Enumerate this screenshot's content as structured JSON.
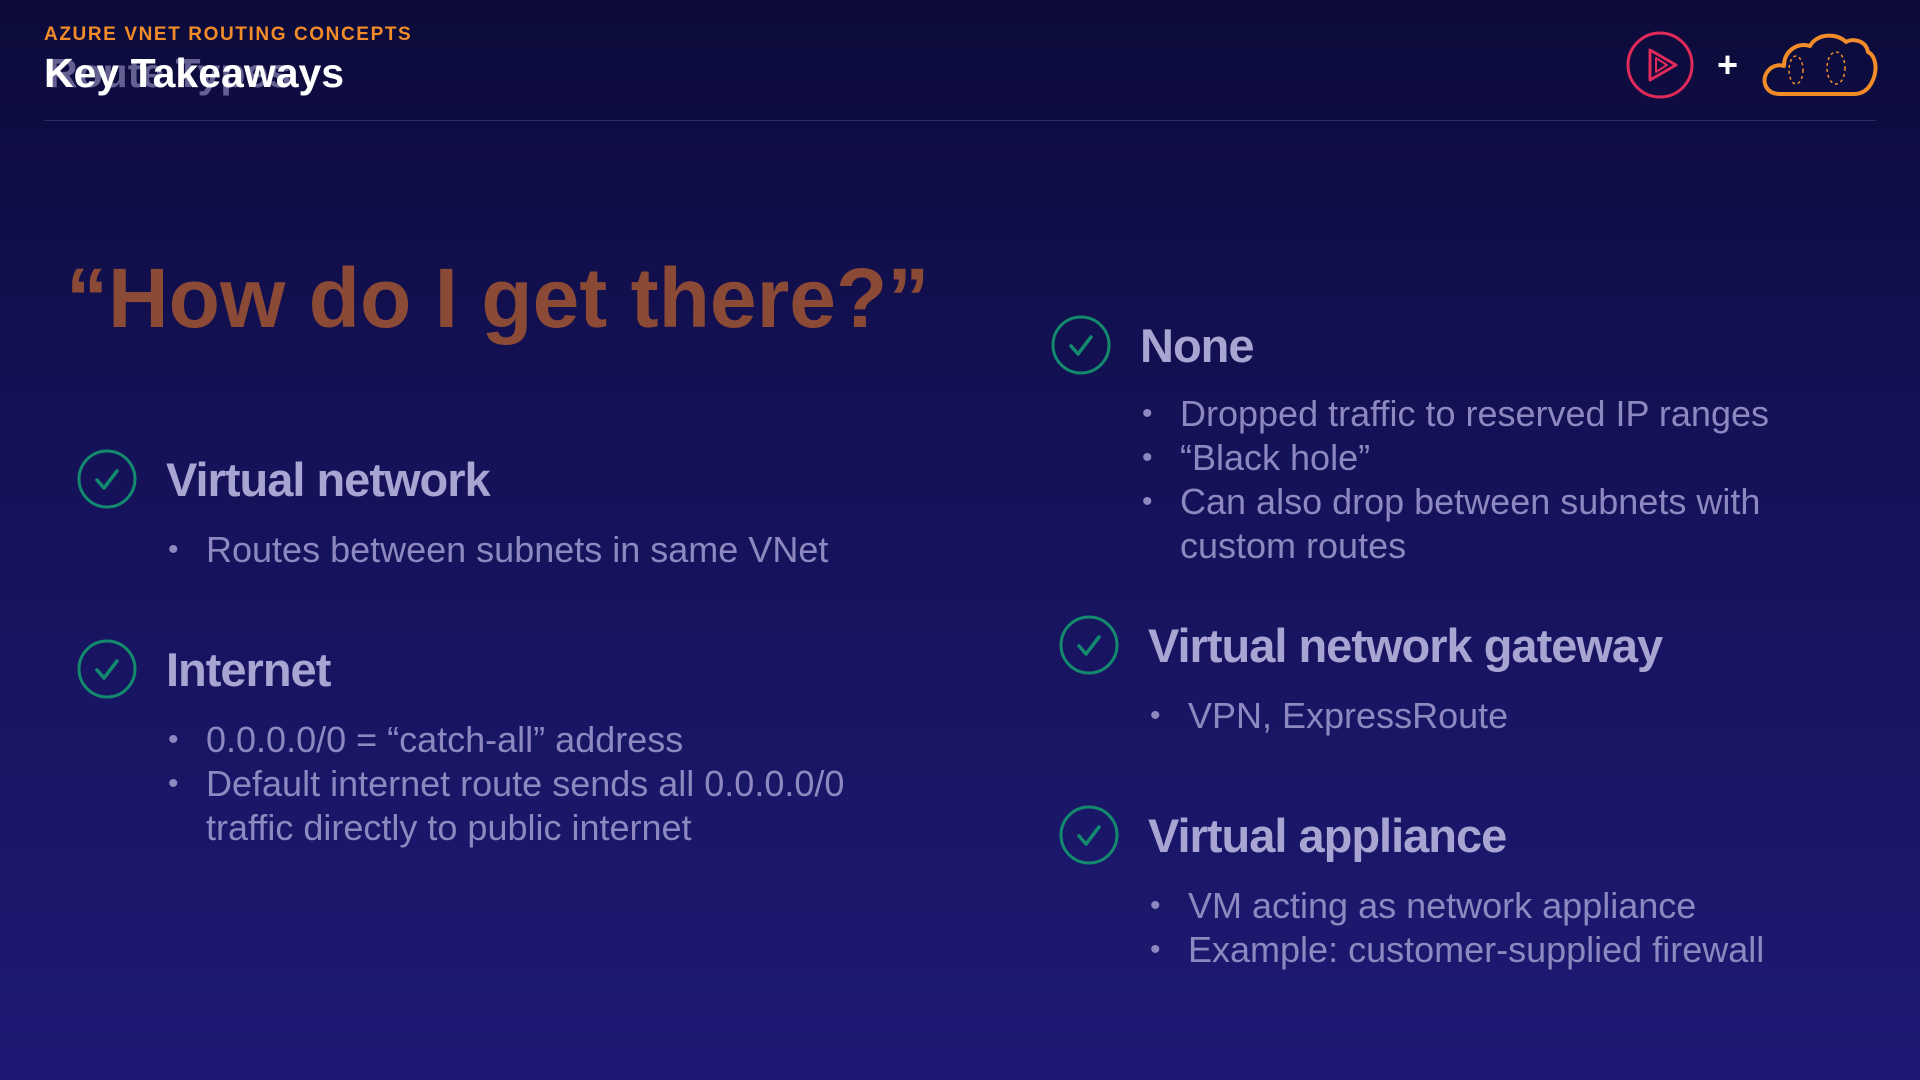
{
  "header": {
    "eyebrow": "AZURE VNET ROUTING CONCEPTS",
    "title": "Key Takeaways",
    "title_ghost": "Route Types"
  },
  "logos": {
    "play_logo": "play-logo-icon",
    "plus": "+",
    "cloud_logo": "cloud-logo-icon"
  },
  "headline": "“How do I get there?”",
  "routes_left": [
    {
      "name": "Virtual network",
      "bullets": [
        "Routes between subnets in same VNet"
      ]
    },
    {
      "name": "Internet",
      "bullets": [
        "0.0.0.0/0 = “catch-all” address",
        "Default internet route sends all 0.0.0.0/0",
        "traffic directly to public internet"
      ]
    }
  ],
  "routes_right": [
    {
      "name": "None",
      "bullets": [
        "Dropped traffic to reserved IP ranges",
        "“Black hole”",
        "Can also drop between subnets with",
        "custom routes"
      ]
    },
    {
      "name": "Virtual network gateway",
      "bullets": [
        "VPN, ExpressRoute"
      ]
    },
    {
      "name": "Virtual appliance",
      "bullets": [
        "VM acting as network appliance",
        "Example: customer-supplied firewall"
      ]
    }
  ],
  "colors": {
    "accent": "#f28c28",
    "play_logo": "#e02a5a",
    "check": "#138a6e",
    "background": "#15125a"
  }
}
